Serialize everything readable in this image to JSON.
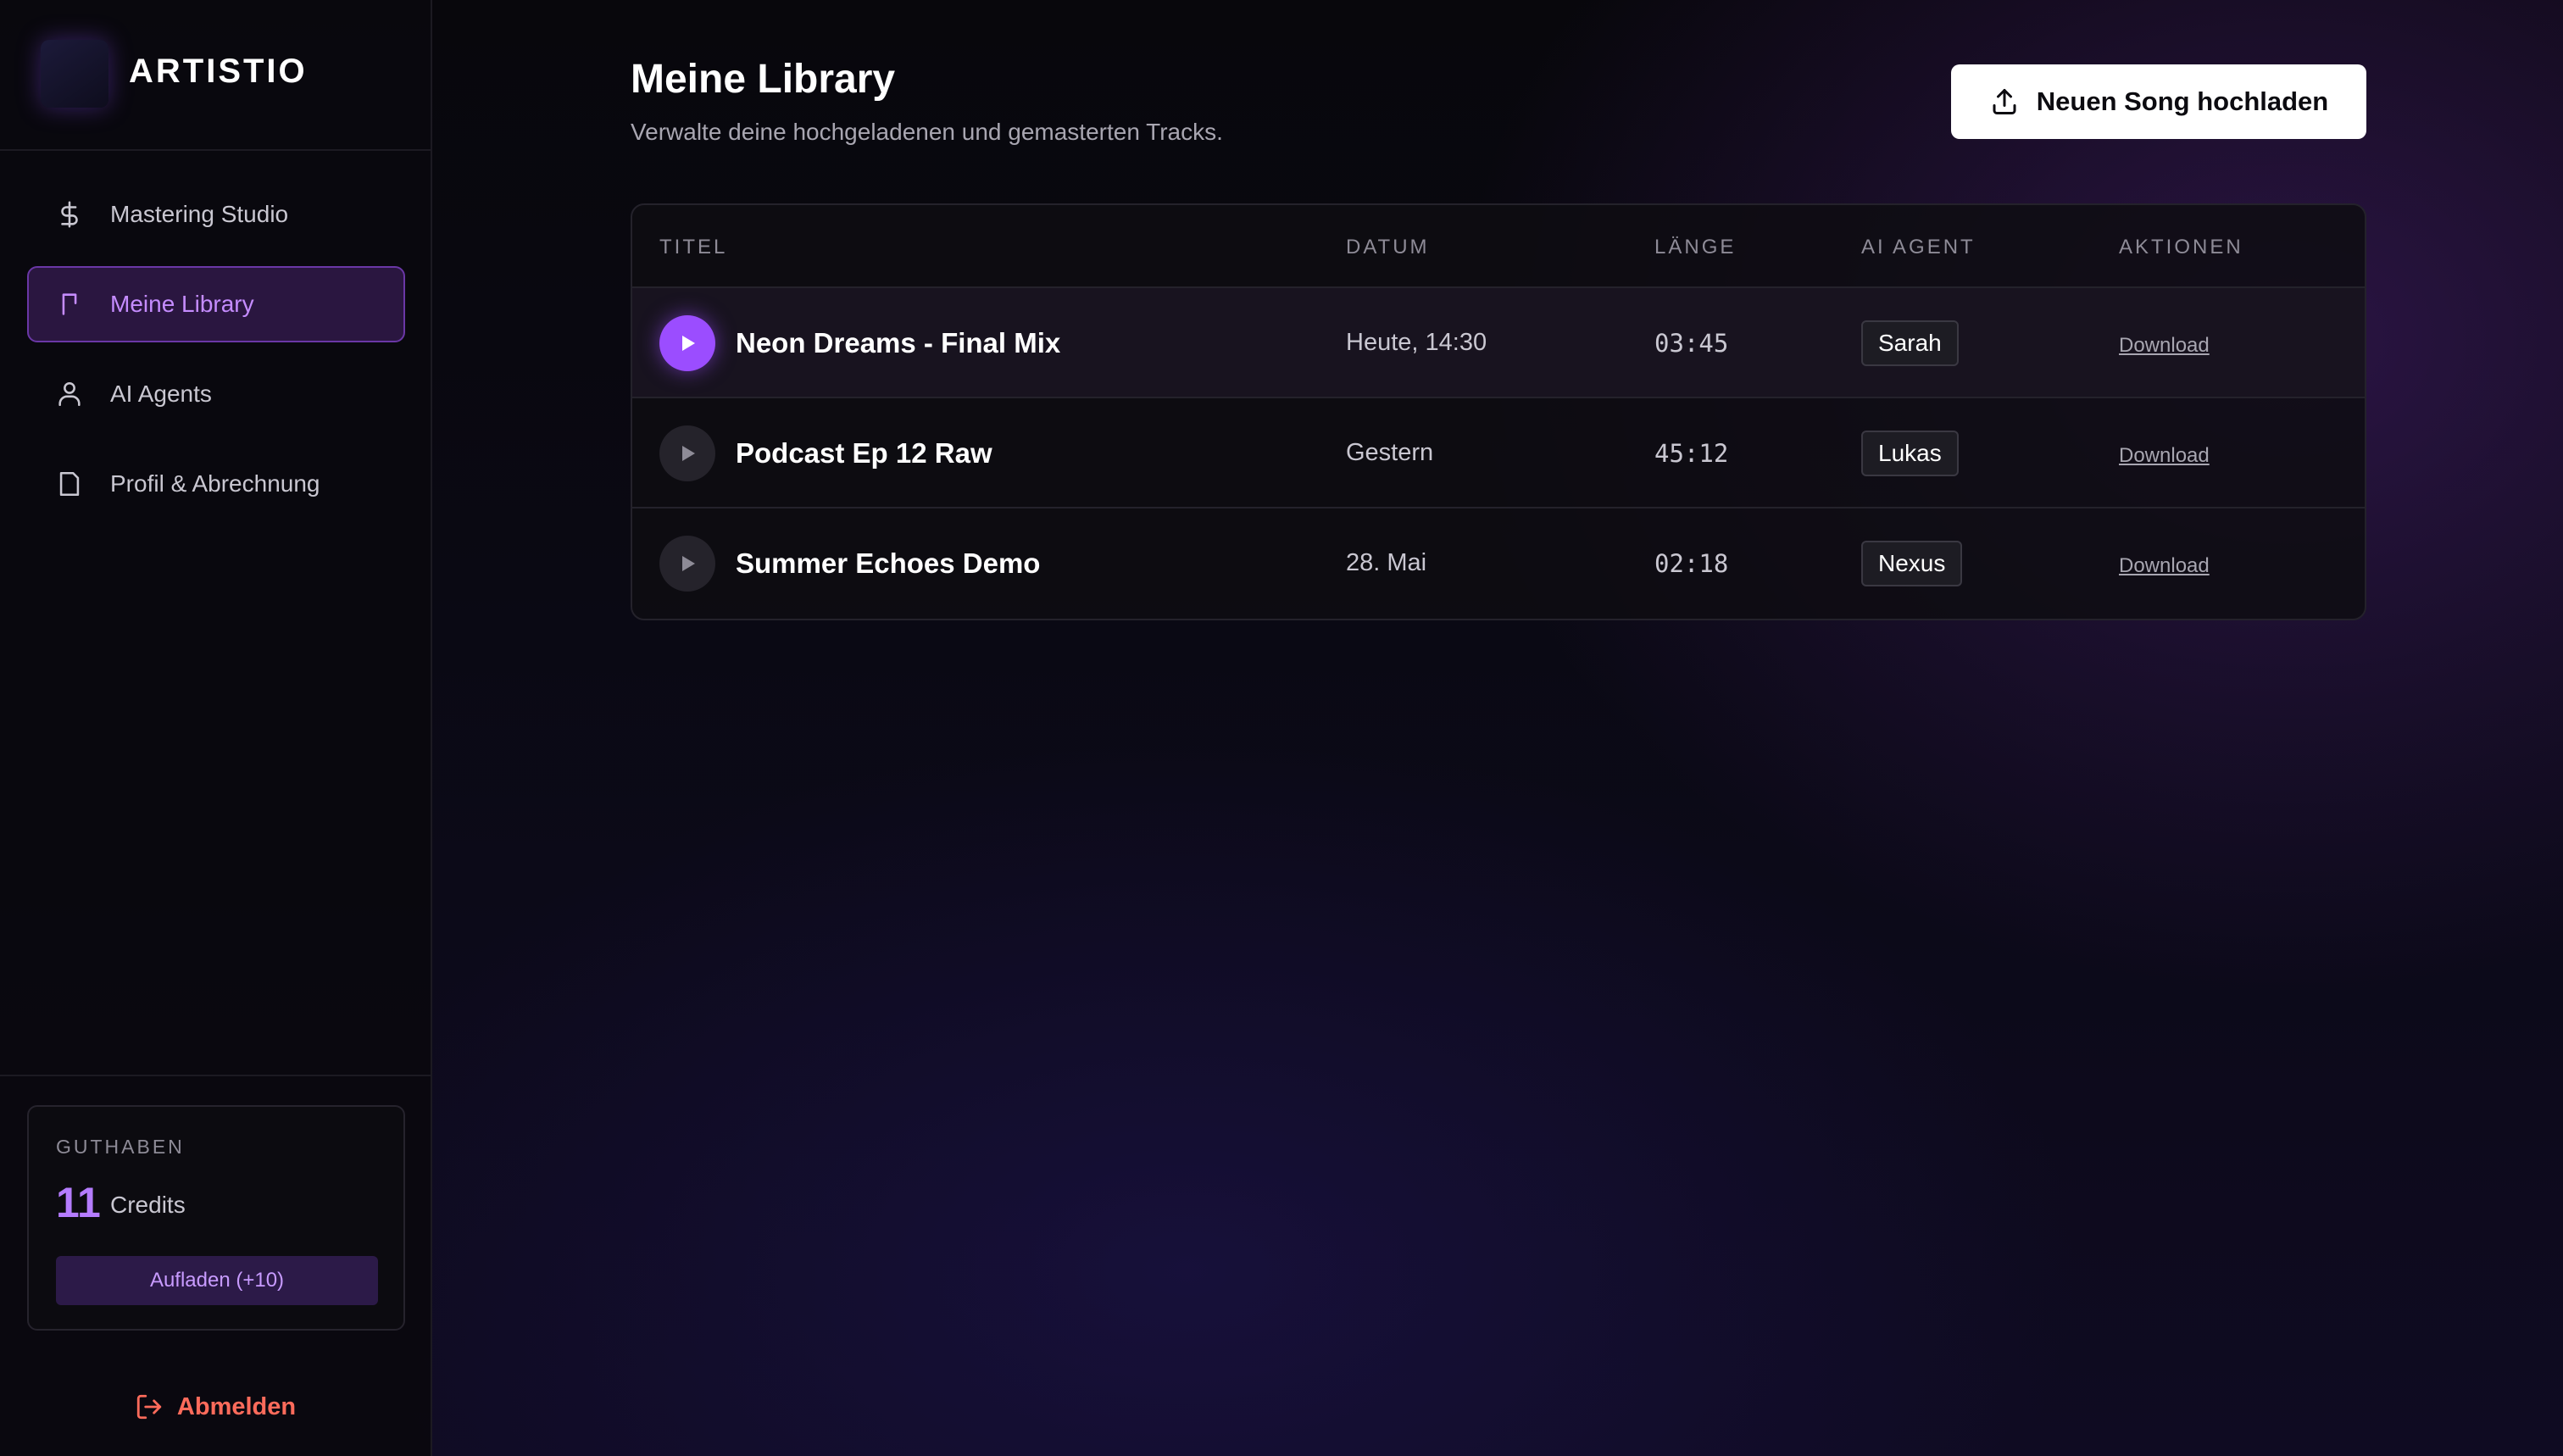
{
  "brand": {
    "name": "ARTISTIO",
    "logo_icon": "waveform-icon",
    "accent": "#b57cff"
  },
  "sidebar": {
    "items": [
      {
        "label": "Mastering Studio",
        "icon": "dollar-icon",
        "active": false
      },
      {
        "label": "Meine Library",
        "icon": "bookmark-icon",
        "active": true
      },
      {
        "label": "AI Agents",
        "icon": "user-icon",
        "active": false
      },
      {
        "label": "Profil & Abrechnung",
        "icon": "document-icon",
        "active": false
      }
    ],
    "credits": {
      "label": "GUTHABEN",
      "count": "11",
      "unit": "Credits",
      "recharge_label": "Aufladen (+10)"
    },
    "logout_label": "Abmelden"
  },
  "main": {
    "title": "Meine Library",
    "subtitle": "Verwalte deine hochgeladenen und gemasterten Tracks.",
    "upload_label": "Neuen Song hochladen",
    "table": {
      "columns": [
        "TITEL",
        "DATUM",
        "LÄNGE",
        "AI AGENT",
        "AKTIONEN"
      ],
      "rows": [
        {
          "title": "Neon Dreams - Final Mix",
          "date": "Heute, 14:30",
          "length": "03:45",
          "agent": "Sarah",
          "action": "Download",
          "playing": true
        },
        {
          "title": "Podcast Ep 12 Raw",
          "date": "Gestern",
          "length": "45:12",
          "agent": "Lukas",
          "action": "Download",
          "playing": false
        },
        {
          "title": "Summer Echoes Demo",
          "date": "28. Mai",
          "length": "02:18",
          "agent": "Nexus",
          "action": "Download",
          "playing": false
        }
      ]
    }
  },
  "colors": {
    "accent_purple": "#9b4dff",
    "logout_red": "#ff6b5b",
    "active_nav_bg": "#2a1640"
  }
}
